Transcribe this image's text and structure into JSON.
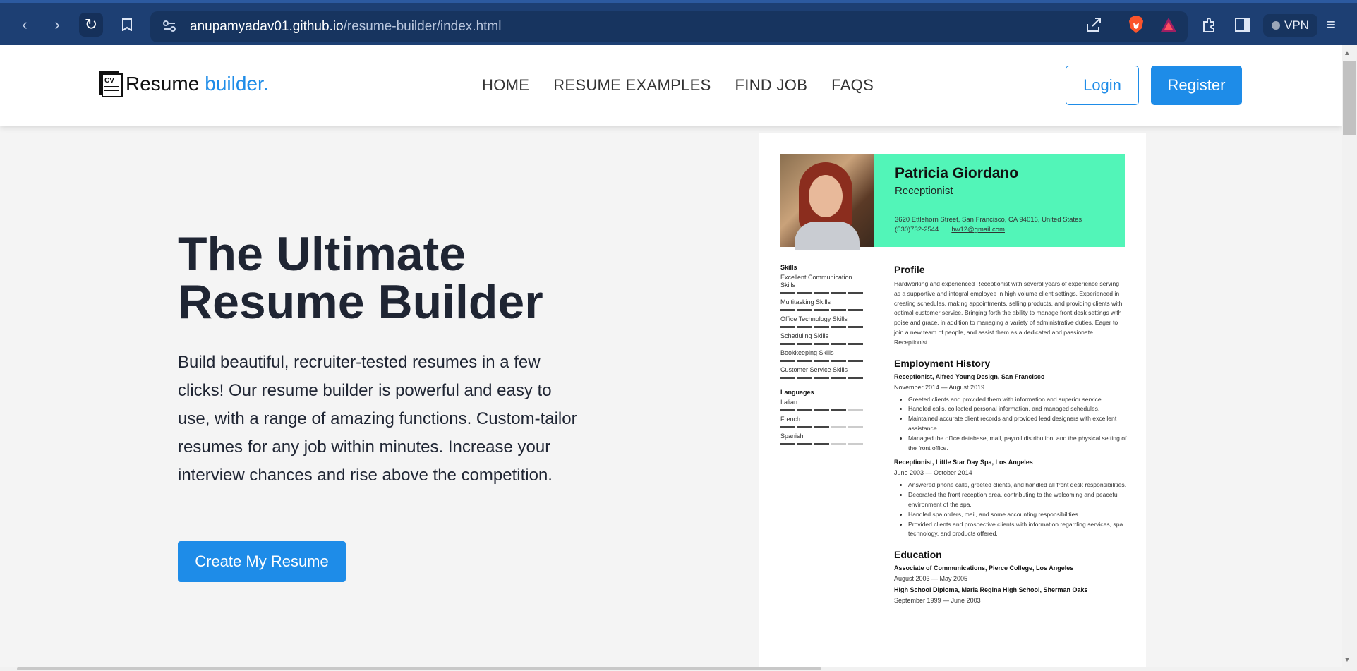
{
  "browser": {
    "url_host": "anupamyadav01.github.io",
    "url_path": "/resume-builder/index.html",
    "vpn_label": "VPN"
  },
  "header": {
    "logo_main": "Resume",
    "logo_accent": "builder.",
    "menu": [
      "HOME",
      "RESUME EXAMPLES",
      "FIND JOB",
      "FAQS"
    ],
    "login": "Login",
    "register": "Register"
  },
  "hero": {
    "title": "The Ultimate Resume Builder",
    "text": "Build beautiful, recruiter-tested resumes in a few clicks! Our resume builder is powerful and easy to use, with a range of amazing functions. Custom-tailor resumes for any job within minutes. Increase your interview chances and rise above the competition.",
    "cta": "Create My Resume"
  },
  "resume": {
    "name": "Patricia Giordano",
    "role": "Receptionist",
    "address": "3620 Ettlehorn Street, San Francisco, CA 94016, United States",
    "phone": "(530)732-2544",
    "email": "hw12@gmail.com",
    "skills_title": "Skills",
    "skills": [
      {
        "name": "Excellent Communication Skills",
        "level": 5
      },
      {
        "name": "Multitasking Skills",
        "level": 5
      },
      {
        "name": "Office Technology Skills",
        "level": 5
      },
      {
        "name": "Scheduling Skills",
        "level": 5
      },
      {
        "name": "Bookkeeping Skills",
        "level": 5
      },
      {
        "name": "Customer Service Skills",
        "level": 5
      }
    ],
    "languages_title": "Languages",
    "languages": [
      {
        "name": "Italian",
        "level": 4
      },
      {
        "name": "French",
        "level": 3
      },
      {
        "name": "Spanish",
        "level": 3
      }
    ],
    "profile_title": "Profile",
    "profile_text": "Hardworking and experienced Receptionist with several years of experience serving as a supportive and integral employee in high volume client settings. Experienced in creating schedules, making appointments, selling products, and providing clients with optimal customer service. Bringing forth the ability to manage front desk settings with poise and grace, in addition to managing a variety of administrative duties. Eager to join a new team of people, and assist them as a dedicated and passionate Receptionist.",
    "employment_title": "Employment History",
    "jobs": [
      {
        "title": "Receptionist, Alfred Young Design, San Francisco",
        "dates": "November 2014 — August 2019",
        "bullets": [
          "Greeted clients and provided them with information and superior service.",
          "Handled calls, collected personal information, and managed schedules.",
          "Maintained accurate client records and provided lead designers with excellent assistance.",
          "Managed the office database, mail, payroll distribution, and the physical setting of the front office."
        ]
      },
      {
        "title": "Receptionist, Little Star Day Spa, Los Angeles",
        "dates": "June 2003 — October 2014",
        "bullets": [
          "Answered phone calls, greeted clients, and handled all front desk responsibilities.",
          "Decorated the front reception area, contributing to the welcoming and peaceful environment of the spa.",
          "Handled spa orders, mail, and some accounting responsibilities.",
          "Provided clients and prospective clients with information regarding services, spa technology, and products offered."
        ]
      }
    ],
    "education_title": "Education",
    "education": [
      {
        "title": "Associate of Communications, Pierce College, Los Angeles",
        "dates": "August 2003 — May 2005"
      },
      {
        "title": "High School Diploma, Maria Regina High School, Sherman Oaks",
        "dates": "September 1999 — June 2003"
      }
    ]
  },
  "colors": {
    "accent": "#1e8ce8",
    "resume_header": "#52f5b8",
    "browser_bar": "#1d3f73"
  }
}
